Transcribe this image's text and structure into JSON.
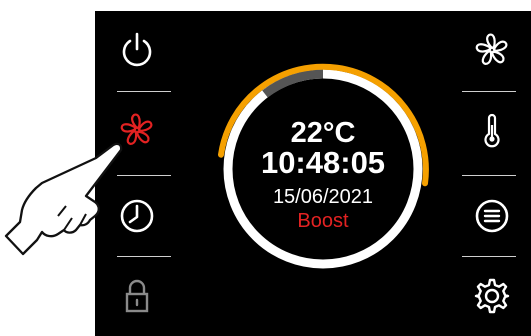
{
  "display": {
    "temperature": "22°C",
    "time": "10:48:05",
    "date": "15/06/2021",
    "mode": "Boost",
    "ring_progress_percent": 50
  },
  "left_buttons": [
    {
      "icon": "power-icon"
    },
    {
      "icon": "fan-icon",
      "active": true
    },
    {
      "icon": "clock-icon"
    },
    {
      "icon": "padlock-icon",
      "disabled": true
    }
  ],
  "right_buttons": [
    {
      "icon": "fan-icon"
    },
    {
      "icon": "thermometer-icon"
    },
    {
      "icon": "menu-icon"
    },
    {
      "icon": "settings-gear-icon"
    }
  ],
  "colors": {
    "background": "#000000",
    "accent": "#f5a000",
    "active_icon": "#e32222",
    "mode_text": "#e32222",
    "icon": "#ffffff",
    "disabled_icon": "#8a8a8a"
  }
}
